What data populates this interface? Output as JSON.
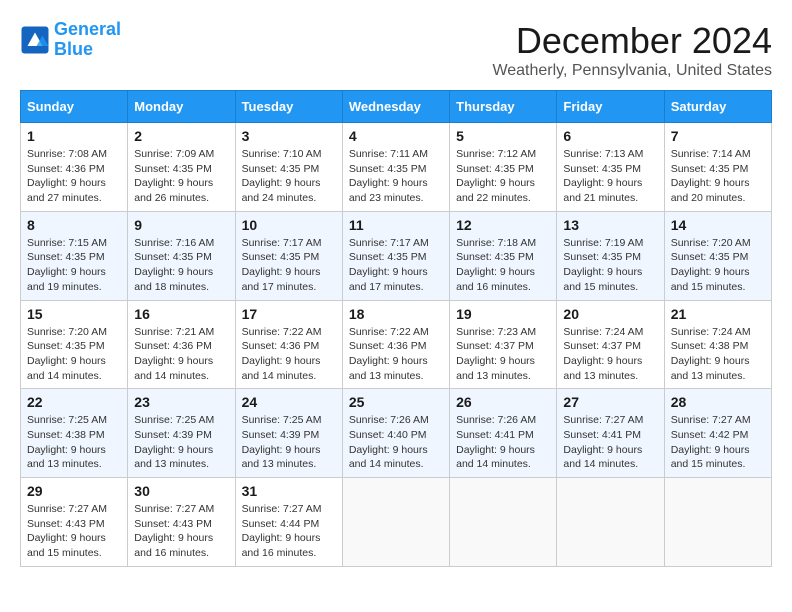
{
  "logo": {
    "line1": "General",
    "line2": "Blue"
  },
  "title": "December 2024",
  "subtitle": "Weatherly, Pennsylvania, United States",
  "days_of_week": [
    "Sunday",
    "Monday",
    "Tuesday",
    "Wednesday",
    "Thursday",
    "Friday",
    "Saturday"
  ],
  "weeks": [
    [
      {
        "day": 1,
        "info": "Sunrise: 7:08 AM\nSunset: 4:36 PM\nDaylight: 9 hours\nand 27 minutes."
      },
      {
        "day": 2,
        "info": "Sunrise: 7:09 AM\nSunset: 4:35 PM\nDaylight: 9 hours\nand 26 minutes."
      },
      {
        "day": 3,
        "info": "Sunrise: 7:10 AM\nSunset: 4:35 PM\nDaylight: 9 hours\nand 24 minutes."
      },
      {
        "day": 4,
        "info": "Sunrise: 7:11 AM\nSunset: 4:35 PM\nDaylight: 9 hours\nand 23 minutes."
      },
      {
        "day": 5,
        "info": "Sunrise: 7:12 AM\nSunset: 4:35 PM\nDaylight: 9 hours\nand 22 minutes."
      },
      {
        "day": 6,
        "info": "Sunrise: 7:13 AM\nSunset: 4:35 PM\nDaylight: 9 hours\nand 21 minutes."
      },
      {
        "day": 7,
        "info": "Sunrise: 7:14 AM\nSunset: 4:35 PM\nDaylight: 9 hours\nand 20 minutes."
      }
    ],
    [
      {
        "day": 8,
        "info": "Sunrise: 7:15 AM\nSunset: 4:35 PM\nDaylight: 9 hours\nand 19 minutes."
      },
      {
        "day": 9,
        "info": "Sunrise: 7:16 AM\nSunset: 4:35 PM\nDaylight: 9 hours\nand 18 minutes."
      },
      {
        "day": 10,
        "info": "Sunrise: 7:17 AM\nSunset: 4:35 PM\nDaylight: 9 hours\nand 17 minutes."
      },
      {
        "day": 11,
        "info": "Sunrise: 7:17 AM\nSunset: 4:35 PM\nDaylight: 9 hours\nand 17 minutes."
      },
      {
        "day": 12,
        "info": "Sunrise: 7:18 AM\nSunset: 4:35 PM\nDaylight: 9 hours\nand 16 minutes."
      },
      {
        "day": 13,
        "info": "Sunrise: 7:19 AM\nSunset: 4:35 PM\nDaylight: 9 hours\nand 15 minutes."
      },
      {
        "day": 14,
        "info": "Sunrise: 7:20 AM\nSunset: 4:35 PM\nDaylight: 9 hours\nand 15 minutes."
      }
    ],
    [
      {
        "day": 15,
        "info": "Sunrise: 7:20 AM\nSunset: 4:35 PM\nDaylight: 9 hours\nand 14 minutes."
      },
      {
        "day": 16,
        "info": "Sunrise: 7:21 AM\nSunset: 4:36 PM\nDaylight: 9 hours\nand 14 minutes."
      },
      {
        "day": 17,
        "info": "Sunrise: 7:22 AM\nSunset: 4:36 PM\nDaylight: 9 hours\nand 14 minutes."
      },
      {
        "day": 18,
        "info": "Sunrise: 7:22 AM\nSunset: 4:36 PM\nDaylight: 9 hours\nand 13 minutes."
      },
      {
        "day": 19,
        "info": "Sunrise: 7:23 AM\nSunset: 4:37 PM\nDaylight: 9 hours\nand 13 minutes."
      },
      {
        "day": 20,
        "info": "Sunrise: 7:24 AM\nSunset: 4:37 PM\nDaylight: 9 hours\nand 13 minutes."
      },
      {
        "day": 21,
        "info": "Sunrise: 7:24 AM\nSunset: 4:38 PM\nDaylight: 9 hours\nand 13 minutes."
      }
    ],
    [
      {
        "day": 22,
        "info": "Sunrise: 7:25 AM\nSunset: 4:38 PM\nDaylight: 9 hours\nand 13 minutes."
      },
      {
        "day": 23,
        "info": "Sunrise: 7:25 AM\nSunset: 4:39 PM\nDaylight: 9 hours\nand 13 minutes."
      },
      {
        "day": 24,
        "info": "Sunrise: 7:25 AM\nSunset: 4:39 PM\nDaylight: 9 hours\nand 13 minutes."
      },
      {
        "day": 25,
        "info": "Sunrise: 7:26 AM\nSunset: 4:40 PM\nDaylight: 9 hours\nand 14 minutes."
      },
      {
        "day": 26,
        "info": "Sunrise: 7:26 AM\nSunset: 4:41 PM\nDaylight: 9 hours\nand 14 minutes."
      },
      {
        "day": 27,
        "info": "Sunrise: 7:27 AM\nSunset: 4:41 PM\nDaylight: 9 hours\nand 14 minutes."
      },
      {
        "day": 28,
        "info": "Sunrise: 7:27 AM\nSunset: 4:42 PM\nDaylight: 9 hours\nand 15 minutes."
      }
    ],
    [
      {
        "day": 29,
        "info": "Sunrise: 7:27 AM\nSunset: 4:43 PM\nDaylight: 9 hours\nand 15 minutes."
      },
      {
        "day": 30,
        "info": "Sunrise: 7:27 AM\nSunset: 4:43 PM\nDaylight: 9 hours\nand 16 minutes."
      },
      {
        "day": 31,
        "info": "Sunrise: 7:27 AM\nSunset: 4:44 PM\nDaylight: 9 hours\nand 16 minutes."
      },
      null,
      null,
      null,
      null
    ]
  ]
}
